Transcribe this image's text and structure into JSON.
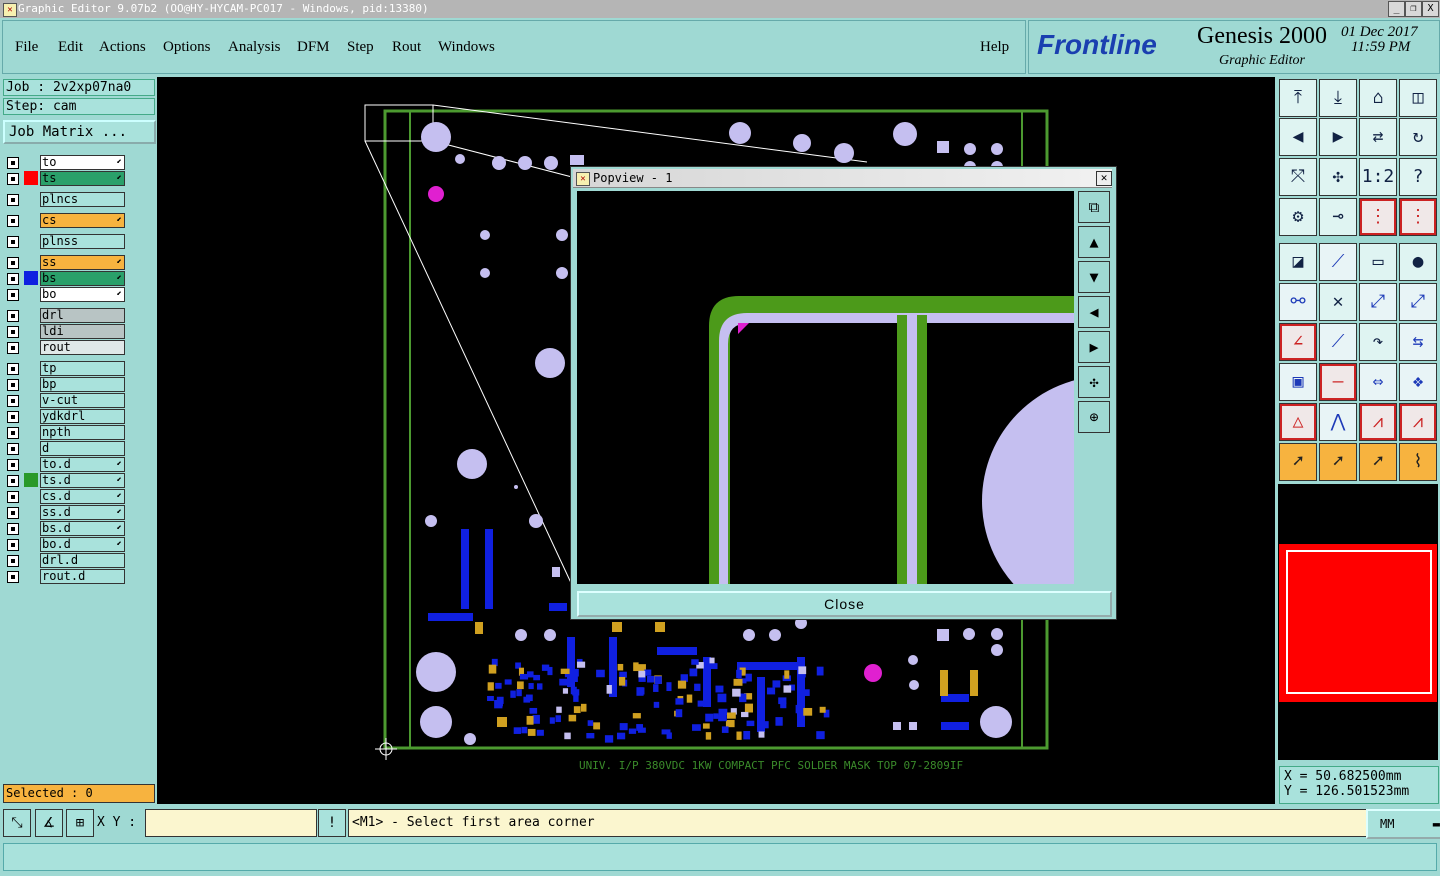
{
  "window": {
    "title": "Graphic Editor 9.07b2 (OO@HY-HYCAM-PC017 - Windows, pid:13380)",
    "controls": [
      "_",
      "❐",
      "X"
    ]
  },
  "menubar": {
    "items": [
      "File",
      "Edit",
      "Actions",
      "Options",
      "Analysis",
      "DFM",
      "Step",
      "Rout",
      "Windows"
    ],
    "help": "Help"
  },
  "brand": {
    "logo": "Frontline",
    "product": "Genesis 2000",
    "subtitle": "Graphic Editor",
    "date": "01 Dec 2017",
    "time": "11:59 PM"
  },
  "job": {
    "job": "Job : 2v2xp07na0",
    "step": "Step: cam",
    "matrix_button": "Job Matrix ..."
  },
  "layers": [
    {
      "name": "to",
      "bg": "#ffffff",
      "swatch": "",
      "arrow": true
    },
    {
      "name": "ts",
      "bg": "#2aa06a",
      "swatch": "#ff0000",
      "arrow": true
    },
    {
      "name": "plncs",
      "bg": "#a9e2dc",
      "swatch": "",
      "arrow": false
    },
    {
      "name": "cs",
      "bg": "#f7b33f",
      "swatch": "",
      "arrow": true
    },
    {
      "name": "plnss",
      "bg": "#a9e2dc",
      "swatch": "",
      "arrow": false
    },
    {
      "name": "ss",
      "bg": "#f7b33f",
      "swatch": "",
      "arrow": true
    },
    {
      "name": "bs",
      "bg": "#2aa06a",
      "swatch": "#1020e0",
      "arrow": true
    },
    {
      "name": "bo",
      "bg": "#ffffff",
      "swatch": "",
      "arrow": true
    },
    {
      "name": "drl",
      "bg": "#b8c4c4",
      "swatch": "",
      "arrow": false
    },
    {
      "name": "ldi",
      "bg": "#b8c4c4",
      "swatch": "",
      "arrow": false
    },
    {
      "name": "rout",
      "bg": "#e0e8e8",
      "swatch": "",
      "arrow": false
    },
    {
      "name": "tp",
      "bg": "#a9e2dc",
      "swatch": "",
      "arrow": false
    },
    {
      "name": "bp",
      "bg": "#a9e2dc",
      "swatch": "",
      "arrow": false
    },
    {
      "name": "v-cut",
      "bg": "#a9e2dc",
      "swatch": "",
      "arrow": false
    },
    {
      "name": "ydkdrl",
      "bg": "#a9e2dc",
      "swatch": "",
      "arrow": false
    },
    {
      "name": "npth",
      "bg": "#a9e2dc",
      "swatch": "",
      "arrow": false
    },
    {
      "name": "d",
      "bg": "#a9e2dc",
      "swatch": "",
      "arrow": false
    },
    {
      "name": "to.d",
      "bg": "#a9e2dc",
      "swatch": "",
      "arrow": true
    },
    {
      "name": "ts.d",
      "bg": "#a9e2dc",
      "swatch": "#2a9a2a",
      "arrow": true
    },
    {
      "name": "cs.d",
      "bg": "#a9e2dc",
      "swatch": "",
      "arrow": true
    },
    {
      "name": "ss.d",
      "bg": "#a9e2dc",
      "swatch": "",
      "arrow": true
    },
    {
      "name": "bs.d",
      "bg": "#a9e2dc",
      "swatch": "",
      "arrow": true
    },
    {
      "name": "bo.d",
      "bg": "#a9e2dc",
      "swatch": "",
      "arrow": true
    },
    {
      "name": "drl.d",
      "bg": "#a9e2dc",
      "swatch": "",
      "arrow": false
    },
    {
      "name": "rout.d",
      "bg": "#a9e2dc",
      "swatch": "",
      "arrow": false
    }
  ],
  "selected": "Selected : 0",
  "canvas": {
    "board_label": "UNIV. I/P 380VDC 1KW COMPACT PFC SOLDER MASK TOP 07-2809IF"
  },
  "popview": {
    "title": "Popview - 1",
    "close_label": "Close"
  },
  "coords": {
    "x": "X  =  50.682500mm",
    "y": "Y  = 126.501523mm"
  },
  "bottom": {
    "xy_label": "X Y :",
    "xy_value": "",
    "prompt": "<M1> - Select first area corner",
    "unit": "MM"
  },
  "colors": {
    "panel": "#9fd9d3",
    "accent_orange": "#f7b33f",
    "feature_lilac": "#c5bff0",
    "pad_blue": "#1020e0",
    "board_green": "#2f8a22"
  }
}
